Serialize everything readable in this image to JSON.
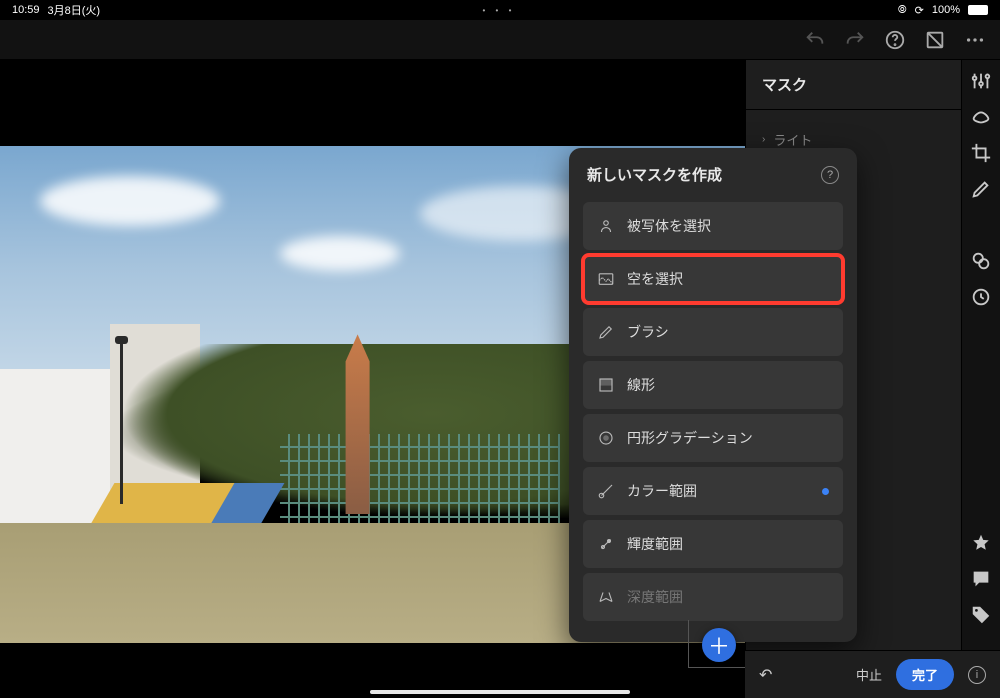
{
  "statusbar": {
    "time": "10:59",
    "date": "3月8日(火)",
    "battery": "100%"
  },
  "panel": {
    "title": "マスク",
    "group_light": "ライト"
  },
  "popover": {
    "title": "新しいマスクを作成",
    "items": {
      "subject": "被写体を選択",
      "sky": "空を選択",
      "brush": "ブラシ",
      "linear": "線形",
      "radial": "円形グラデーション",
      "color": "カラー範囲",
      "luminance": "輝度範囲",
      "depth": "深度範囲"
    }
  },
  "footer": {
    "cancel": "中止",
    "done": "完了"
  }
}
